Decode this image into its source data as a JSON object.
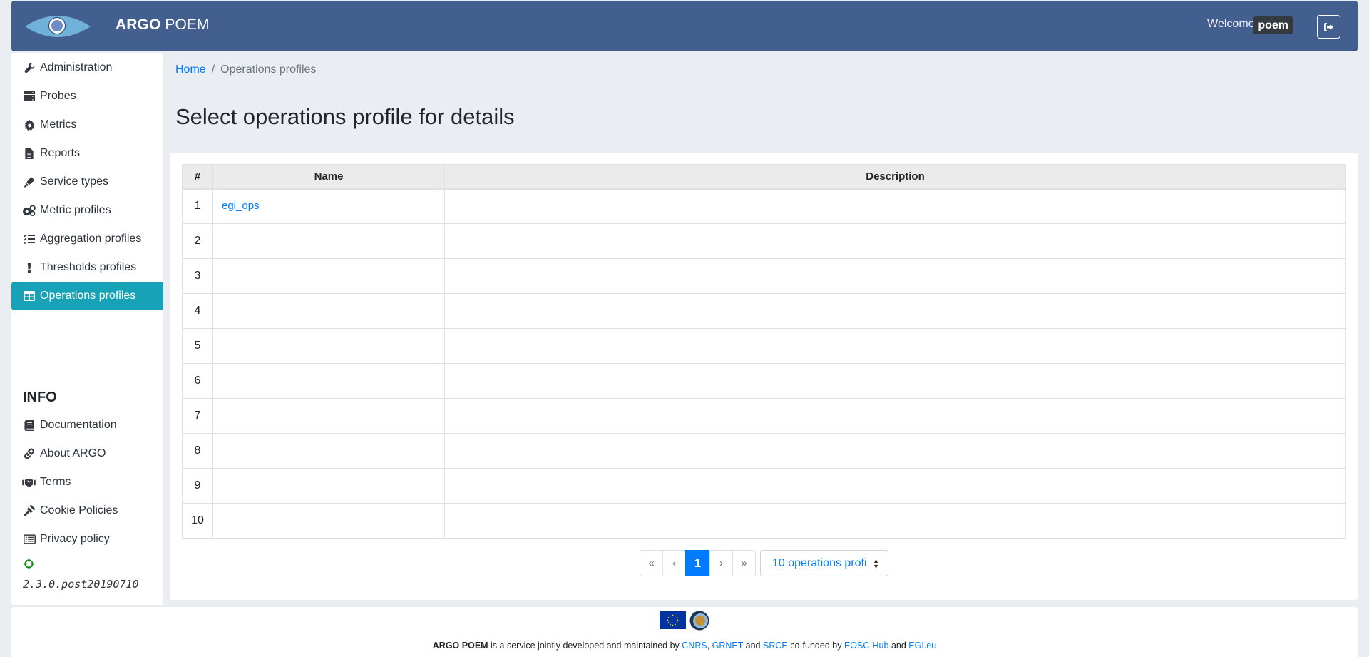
{
  "header": {
    "brand_bold": "ARGO",
    "brand_light": " POEM",
    "welcome": "Welcome,",
    "username": "poem",
    "logout_icon": "sign-out-icon"
  },
  "sidebar": {
    "items": [
      {
        "label": "Administration",
        "icon": "wrench-icon"
      },
      {
        "label": "Probes",
        "icon": "server-icon"
      },
      {
        "label": "Metrics",
        "icon": "cog-icon"
      },
      {
        "label": "Reports",
        "icon": "file-icon"
      },
      {
        "label": "Service types",
        "icon": "highlighter-icon"
      },
      {
        "label": "Metric profiles",
        "icon": "cogs-icon"
      },
      {
        "label": "Aggregation profiles",
        "icon": "tasks-icon"
      },
      {
        "label": "Thresholds profiles",
        "icon": "exclamation-icon"
      },
      {
        "label": "Operations profiles",
        "icon": "table-icon",
        "active": true
      }
    ],
    "info_title": "INFO",
    "info_items": [
      {
        "label": "Documentation",
        "icon": "book-icon"
      },
      {
        "label": "About ARGO",
        "icon": "link-icon"
      },
      {
        "label": "Terms",
        "icon": "handshake-icon"
      },
      {
        "label": "Cookie Policies",
        "icon": "gavel-icon"
      },
      {
        "label": "Privacy policy",
        "icon": "list-alt-icon"
      }
    ],
    "version": "2.3.0.post20190710",
    "version_icon": "crosshairs-icon"
  },
  "breadcrumb": {
    "home": "Home",
    "separator": "/",
    "current": "Operations profiles"
  },
  "page_title": "Select operations profile for details",
  "table": {
    "columns": [
      "#",
      "Name",
      "Description"
    ],
    "rows": [
      {
        "num": "1",
        "name": "egi_ops",
        "description": ""
      },
      {
        "num": "2",
        "name": "",
        "description": ""
      },
      {
        "num": "3",
        "name": "",
        "description": ""
      },
      {
        "num": "4",
        "name": "",
        "description": ""
      },
      {
        "num": "5",
        "name": "",
        "description": ""
      },
      {
        "num": "6",
        "name": "",
        "description": ""
      },
      {
        "num": "7",
        "name": "",
        "description": ""
      },
      {
        "num": "8",
        "name": "",
        "description": ""
      },
      {
        "num": "9",
        "name": "",
        "description": ""
      },
      {
        "num": "10",
        "name": "",
        "description": ""
      }
    ]
  },
  "pagination": {
    "first": "«",
    "prev": "‹",
    "current": "1",
    "next": "›",
    "last": "»",
    "page_size": "10 operations profi"
  },
  "footer": {
    "brand": "ARGO POEM",
    "text1": " is a service jointly developed and maintained by ",
    "cnrs": "CNRS",
    "comma": ", ",
    "grnet": "GRNET",
    "and1": " and ",
    "srce": "SRCE",
    "text2": " co-funded by ",
    "eosc": "EOSC-Hub",
    "and2": " and ",
    "egi": "EGI.eu"
  },
  "colors": {
    "header_bg": "#425f8f",
    "active_nav": "#17a2b8",
    "link": "#007bff",
    "page_bg": "#eaedf2"
  }
}
